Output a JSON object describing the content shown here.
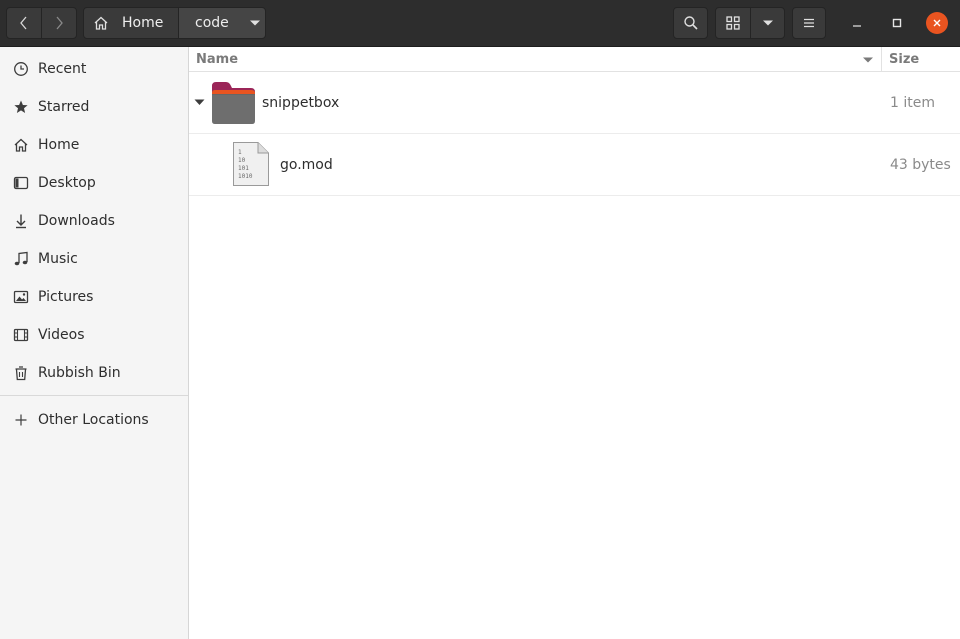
{
  "header": {
    "breadcrumb": [
      {
        "label": "Home",
        "icon": "home-icon"
      },
      {
        "label": "code",
        "icon": "chevron-down-icon"
      }
    ],
    "buttons": {
      "back": "chevron-left-icon",
      "forward": "chevron-right-icon",
      "search": "search-icon",
      "view_grid": "grid-icon",
      "view_options": "chevron-down-icon",
      "menu": "hamburger-menu-icon",
      "minimize": "minimize-icon",
      "maximize": "maximize-icon",
      "close": "close-icon"
    },
    "close_color": "#e95420"
  },
  "sidebar": {
    "items": [
      {
        "label": "Recent",
        "icon": "clock-icon"
      },
      {
        "label": "Starred",
        "icon": "star-icon"
      },
      {
        "label": "Home",
        "icon": "home-icon"
      },
      {
        "label": "Desktop",
        "icon": "desktop-icon"
      },
      {
        "label": "Downloads",
        "icon": "download-icon"
      },
      {
        "label": "Music",
        "icon": "music-icon"
      },
      {
        "label": "Pictures",
        "icon": "picture-icon"
      },
      {
        "label": "Videos",
        "icon": "video-icon"
      },
      {
        "label": "Rubbish Bin",
        "icon": "trash-icon"
      }
    ],
    "other_locations": {
      "label": "Other Locations",
      "icon": "plus-icon"
    }
  },
  "list": {
    "columns": {
      "name": "Name",
      "size": "Size"
    },
    "rows": [
      {
        "name": "snippetbox",
        "size": "1 item",
        "icon": "folder-icon",
        "expanded": true
      },
      {
        "name": "go.mod",
        "size": "43 bytes",
        "icon": "binary-file-icon"
      }
    ]
  }
}
